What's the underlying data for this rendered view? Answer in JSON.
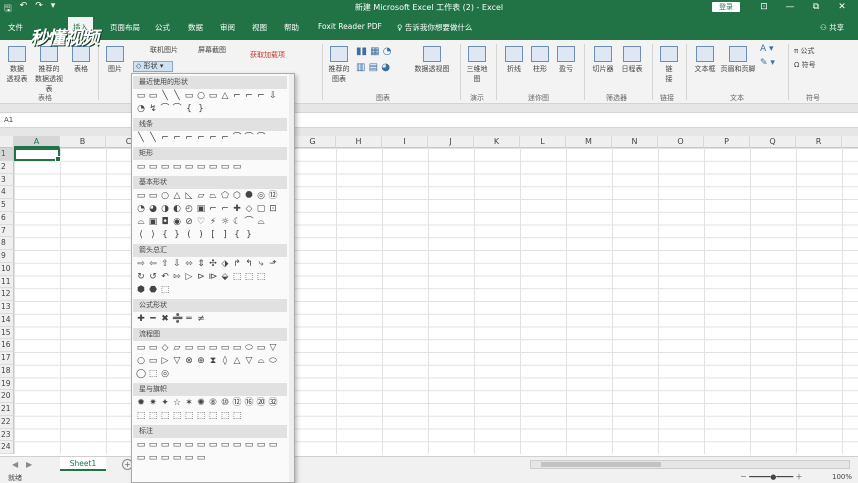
{
  "window": {
    "title": "新建 Microsoft Excel 工作表 (2) - Excel",
    "login_label": "登录",
    "controls": [
      "⊡",
      "—",
      "⧉",
      "✕"
    ]
  },
  "qat": {
    "save": "🖫",
    "undo": "↶",
    "redo": "↷",
    "more": "▾"
  },
  "tabs": [
    {
      "label": "文件",
      "active": false
    },
    {
      "label": "插入",
      "active": true
    },
    {
      "label": "页面布局",
      "active": false
    },
    {
      "label": "公式",
      "active": false
    },
    {
      "label": "数据",
      "active": false
    },
    {
      "label": "审阅",
      "active": false
    },
    {
      "label": "视图",
      "active": false
    },
    {
      "label": "帮助",
      "active": false
    },
    {
      "label": "Foxit Reader PDF",
      "active": false
    }
  ],
  "tell_me": "告诉我你想要做什么",
  "share_label": "共享",
  "watermark": "秒懂视频",
  "ribbon": {
    "items": [
      {
        "label": "数据\n透视表"
      },
      {
        "label": "推荐的\n数据透视表"
      },
      {
        "label": "表格"
      },
      {
        "label": "图片"
      },
      {
        "label": "推荐的\n图表"
      },
      {
        "label": "数据透视图"
      },
      {
        "label": "三维地\n图"
      },
      {
        "label": "折线"
      },
      {
        "label": "柱形"
      },
      {
        "label": "盈亏"
      },
      {
        "label": "切片器"
      },
      {
        "label": "日程表"
      },
      {
        "label": "链\n接"
      },
      {
        "label": "文本框"
      },
      {
        "label": "页眉和页脚"
      }
    ],
    "small_items": [
      "联机图片",
      "屏幕截图",
      "形状",
      "获取加载项",
      "公式",
      "符号"
    ],
    "groups": [
      "表格",
      "图表",
      "演示",
      "迷你图",
      "筛选器",
      "链接",
      "文本",
      "符号"
    ]
  },
  "shapes_button": "形状",
  "name_box": "A1",
  "columns": [
    "A",
    "B",
    "C",
    "D",
    "E",
    "F",
    "G",
    "H",
    "I",
    "J",
    "K",
    "L",
    "M",
    "N",
    "O",
    "P",
    "Q",
    "R"
  ],
  "rows": [
    "1",
    "2",
    "3",
    "4",
    "5",
    "6",
    "7",
    "8",
    "9",
    "10",
    "11",
    "12",
    "13",
    "14",
    "15",
    "16",
    "17",
    "18",
    "19",
    "20",
    "21",
    "22",
    "23",
    "24"
  ],
  "selected_cell": "A1",
  "shapes_panel": {
    "sections": [
      {
        "title": "最近使用的形状",
        "rows": [
          "▭ ▭ ╲ ╲ ▭ ○ ▭ △ ⌐ ⌐ ⌐ ⇩",
          "◔ ↯ ⌒ ⌒ { }"
        ]
      },
      {
        "title": "线条",
        "rows": [
          "╲ ╲ ⌐ ⌐ ⌐ ⌐ ⌐ ⌐ ⌒ ⌒ ⌒"
        ]
      },
      {
        "title": "矩形",
        "rows": [
          "▭ ▭ ▭ ▭ ▭ ▭ ▭ ▭ ▭"
        ]
      },
      {
        "title": "基本形状",
        "rows": [
          "▭ ▭ ○ △ ◺ ▱ ⏢ ⬠ ⬡ ⯃ ◎ ⑫",
          "◔ ◕ ◑ ◐ ◴ ▣ ⌐ ⌐ ✚ ◇ ▢ ⊡",
          "⌓ ▣ ◘ ◉ ⊘ ♡ ⚡ ☼ ☾ ⌒ ⌓",
          "⟨ ⟩ { } ( ) [ ] { }"
        ]
      },
      {
        "title": "箭头总汇",
        "rows": [
          "⇨ ⇦ ⇧ ⇩ ⬄ ⇕ ✣ ⬗ ↱ ↰ ⤷ ⬏",
          "↻ ↺ ↶ ⇰ ▷ ⊳ ⧐ ⬙ ⬚ ⬚ ⬚",
          "⬢ ⬣ ⬚"
        ]
      },
      {
        "title": "公式形状",
        "rows": [
          "✚ ━ ✖ ➗ ═ ≠"
        ]
      },
      {
        "title": "流程图",
        "rows": [
          "▭ ▭ ◇ ▱ ▭ ▭ ▭ ▭ ▭ ⬭ ▭ ▽",
          "○ ▭ ▷ ▽ ⊗ ⊕ ⧗ ◊ △ ▽ ⌓ ⬭",
          "◯ ⬚ ◎"
        ]
      },
      {
        "title": "星与旗帜",
        "rows": [
          "✹ ✷ ✦ ☆ ✶ ✺ ⑧ ⑩ ⑫ ⑯ ⑳ ㉜",
          "⬚ ⬚ ⬚ ⬚ ⬚ ⬚ ⬚ ⬚ ⬚"
        ]
      },
      {
        "title": "标注",
        "rows": [
          "▭ ▭ ▭ ▭ ▭ ▭ ▭ ▭ ▭ ▭ ▭ ▭",
          "▭ ▭ ▭ ▭ ▭ ▭"
        ]
      }
    ]
  },
  "sheet_tab": "Sheet1",
  "status": {
    "ready": "就绪",
    "zoom": "100%"
  }
}
